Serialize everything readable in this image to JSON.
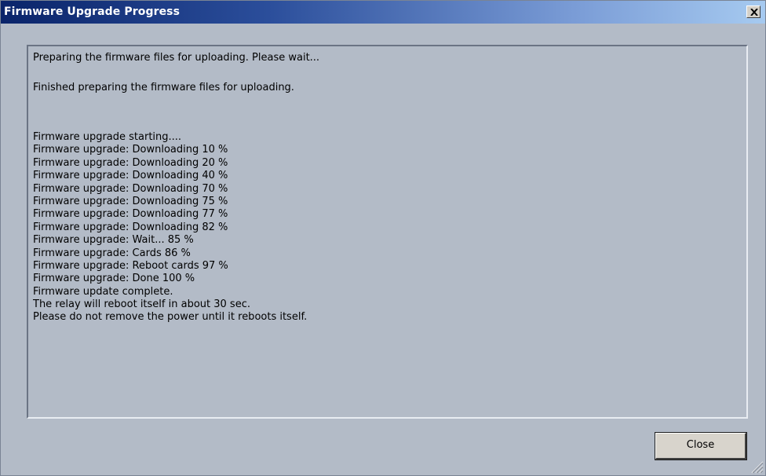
{
  "window": {
    "title": "Firmware Upgrade Progress",
    "close_icon": "close-icon"
  },
  "log": {
    "lines": [
      "Preparing the firmware files for uploading. Please wait...",
      "",
      "Finished preparing the firmware files for uploading.",
      "",
      "",
      "",
      "Firmware upgrade starting....",
      "Firmware upgrade: Downloading 10 %",
      "Firmware upgrade: Downloading 20 %",
      "Firmware upgrade: Downloading 40 %",
      "Firmware upgrade: Downloading 70 %",
      "Firmware upgrade: Downloading 75 %",
      "Firmware upgrade: Downloading 77 %",
      "Firmware upgrade: Downloading 82 %",
      "Firmware upgrade: Wait... 85 %",
      "Firmware upgrade: Cards 86 %",
      "Firmware upgrade: Reboot cards 97 %",
      "Firmware upgrade: Done 100 %",
      "Firmware update complete.",
      "The relay will reboot itself in about 30 sec.",
      "Please do not remove the power until it reboots itself."
    ]
  },
  "buttons": {
    "close_label": "Close"
  },
  "colors": {
    "title_gradient_start": "#0a246a",
    "title_gradient_end": "#a6caf0",
    "body_background": "#b3bbc7"
  }
}
